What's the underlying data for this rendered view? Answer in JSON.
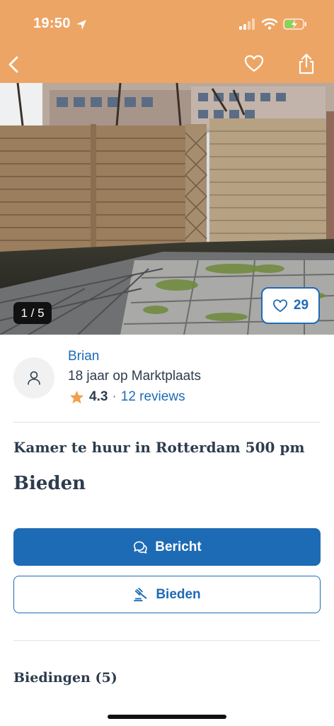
{
  "status_bar": {
    "time": "19:50"
  },
  "listing": {
    "photo_counter": "1 / 5",
    "favorites_count": "29",
    "title": "Kamer te huur in Rotterdam 500 pm",
    "price": "Bieden"
  },
  "seller": {
    "name": "Brian",
    "since": "18 jaar op Marktplaats",
    "rating": "4.3",
    "separator": "·",
    "reviews": "12 reviews"
  },
  "actions": {
    "message_label": "Bericht",
    "bid_label": "Bieden"
  },
  "bids": {
    "heading": "Biedingen (5)"
  },
  "icons": {
    "back": "chevron-left-icon",
    "favorite": "heart-icon",
    "share": "share-icon",
    "avatar": "user-icon",
    "star": "star-icon",
    "message": "chat-bubbles-icon",
    "bid": "gavel-icon"
  },
  "colors": {
    "header": "#eda565",
    "primary": "#1e6bb5",
    "star": "#f0a04b"
  }
}
